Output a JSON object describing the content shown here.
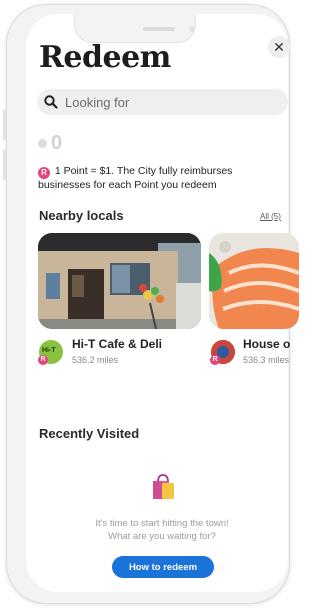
{
  "header": {
    "title": "Redeem"
  },
  "search": {
    "placeholder": "Looking for"
  },
  "points": {
    "value": "0"
  },
  "info": {
    "badge": "R",
    "text": "1 Point = $1. The City fully reimburses businesses for each Point you redeem"
  },
  "nearby": {
    "title": "Nearby locals",
    "all_label": "All (5)",
    "places": [
      {
        "name": "Hi-T Cafe & Deli",
        "distance": "536.2 miles",
        "logo_text": "Hi-T",
        "badge": "R"
      },
      {
        "name": "House o",
        "distance": "536.3 miles",
        "badge": "R"
      }
    ]
  },
  "recent": {
    "title": "Recently Visited",
    "empty_line1": "It's time to start hitting the town!",
    "empty_line2": "What are you waiting for?",
    "cta_label": "How to redeem"
  },
  "colors": {
    "accent": "#1a73d9",
    "badge": "#e8417b"
  }
}
